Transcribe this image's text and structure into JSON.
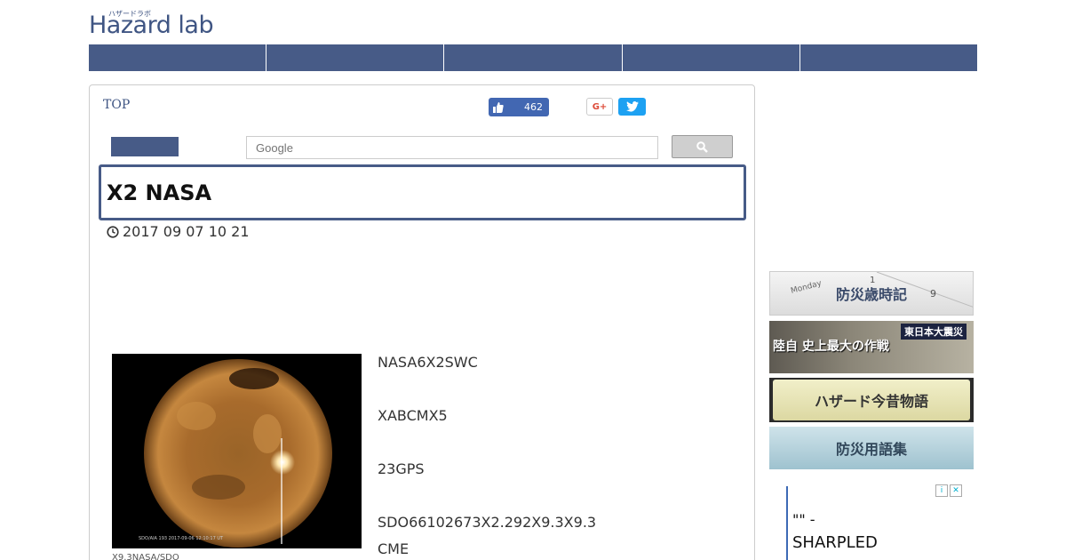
{
  "logo": {
    "ruby": "ハザードラボ",
    "name": "Hazard lab"
  },
  "nav": {
    "items": [
      "",
      "",
      "",
      "",
      ""
    ]
  },
  "breadcrumb": {
    "label": "TOP"
  },
  "social": {
    "like_count": "462",
    "gplus_label": "G+"
  },
  "search": {
    "placeholder": "Google"
  },
  "article": {
    "title": "X2 NASA",
    "date": "2017  09  07   10  21",
    "paragraphs": [
      "NASA6X2SWC",
      "XABCMX5",
      "23GPS",
      "SDO66102673X2.292X9.3X9.3",
      "CME"
    ],
    "caption": "X9.3NASA/SDO"
  },
  "sidebar": {
    "banners": [
      "防災歳時記",
      "陸自 史上最大の作戦",
      "東日本大震災",
      "ハザード今昔物語",
      "防災用語集"
    ]
  },
  "ad": {
    "line1": "\"\" -",
    "line2": "SHARPLED"
  },
  "colors": {
    "nav": "#475b87",
    "accent": "#3f5583"
  }
}
